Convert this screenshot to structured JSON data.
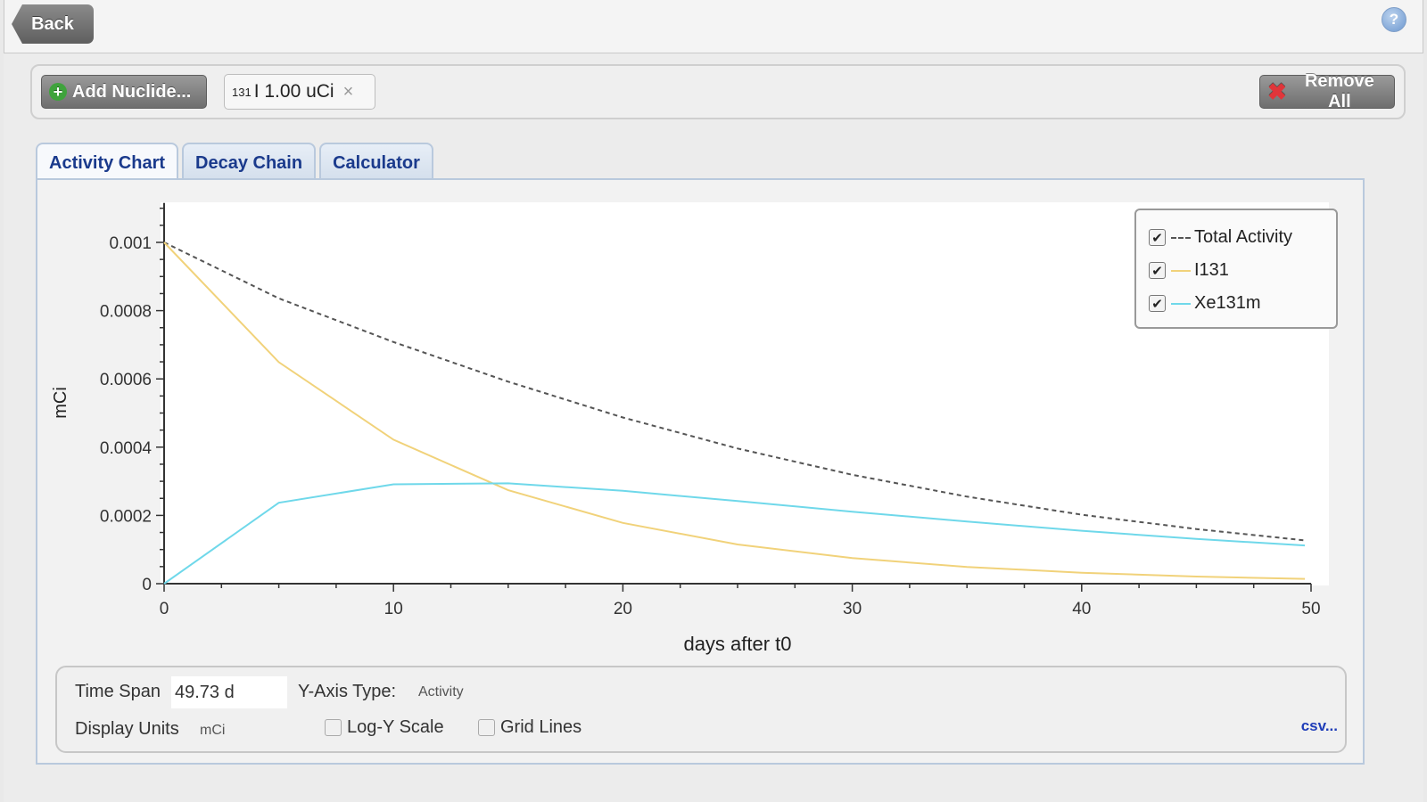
{
  "header": {
    "back_label": "Back",
    "help_icon": "help-icon"
  },
  "toolbar": {
    "add_label": "Add Nuclide...",
    "remove_label": "Remove All",
    "chip": {
      "mass": "131",
      "label": "I 1.00 uCi",
      "close": "×"
    }
  },
  "tabs": [
    {
      "label": "Activity Chart",
      "active": true
    },
    {
      "label": "Decay Chain",
      "active": false
    },
    {
      "label": "Calculator",
      "active": false
    }
  ],
  "chart_data": {
    "type": "line",
    "xlabel": "days after t0",
    "ylabel": "mCi",
    "xlim": [
      0,
      50
    ],
    "ylim": [
      0,
      0.0011
    ],
    "xticks": [
      0,
      10,
      20,
      30,
      40,
      50
    ],
    "yticks": [
      0,
      0.0002,
      0.0004,
      0.0006,
      0.0008,
      0.001
    ],
    "grid": false,
    "legend_position": "top-right",
    "series": [
      {
        "name": "Total Activity",
        "color": "#555555",
        "dashed": true,
        "checked": true,
        "x": [
          0,
          5,
          10,
          15,
          20,
          25,
          30,
          35,
          40,
          45,
          49.73
        ],
        "y": [
          0.001,
          0.000836,
          0.000708,
          0.000592,
          0.000487,
          0.000396,
          0.000319,
          0.000255,
          0.000202,
          0.00016,
          0.000127
        ]
      },
      {
        "name": "I131",
        "color": "#f1d27a",
        "dashed": false,
        "checked": true,
        "x": [
          0,
          5,
          10,
          15,
          20,
          25,
          30,
          35,
          40,
          45,
          49.73
        ],
        "y": [
          0.001,
          0.000649,
          0.000422,
          0.000274,
          0.000178,
          0.000115,
          7.5e-05,
          4.9e-05,
          3.2e-05,
          2.1e-05,
          1.4e-05
        ]
      },
      {
        "name": "Xe131m",
        "color": "#6fd8ea",
        "dashed": false,
        "checked": true,
        "x": [
          0,
          5,
          10,
          15,
          20,
          25,
          30,
          35,
          40,
          45,
          49.73
        ],
        "y": [
          0,
          0.000237,
          0.000291,
          0.000294,
          0.000272,
          0.000242,
          0.000211,
          0.000182,
          0.000155,
          0.000131,
          0.000112
        ]
      }
    ]
  },
  "settings": {
    "time_span_label": "Time Span",
    "time_span_value": "49.73 d",
    "y_axis_type_label": "Y-Axis Type:",
    "y_axis_type_value": "Activity",
    "display_units_label": "Display Units",
    "display_units_value": "mCi",
    "log_y_label": "Log-Y Scale",
    "log_y_checked": false,
    "grid_lines_label": "Grid Lines",
    "grid_lines_checked": false,
    "csv_label": "csv..."
  }
}
